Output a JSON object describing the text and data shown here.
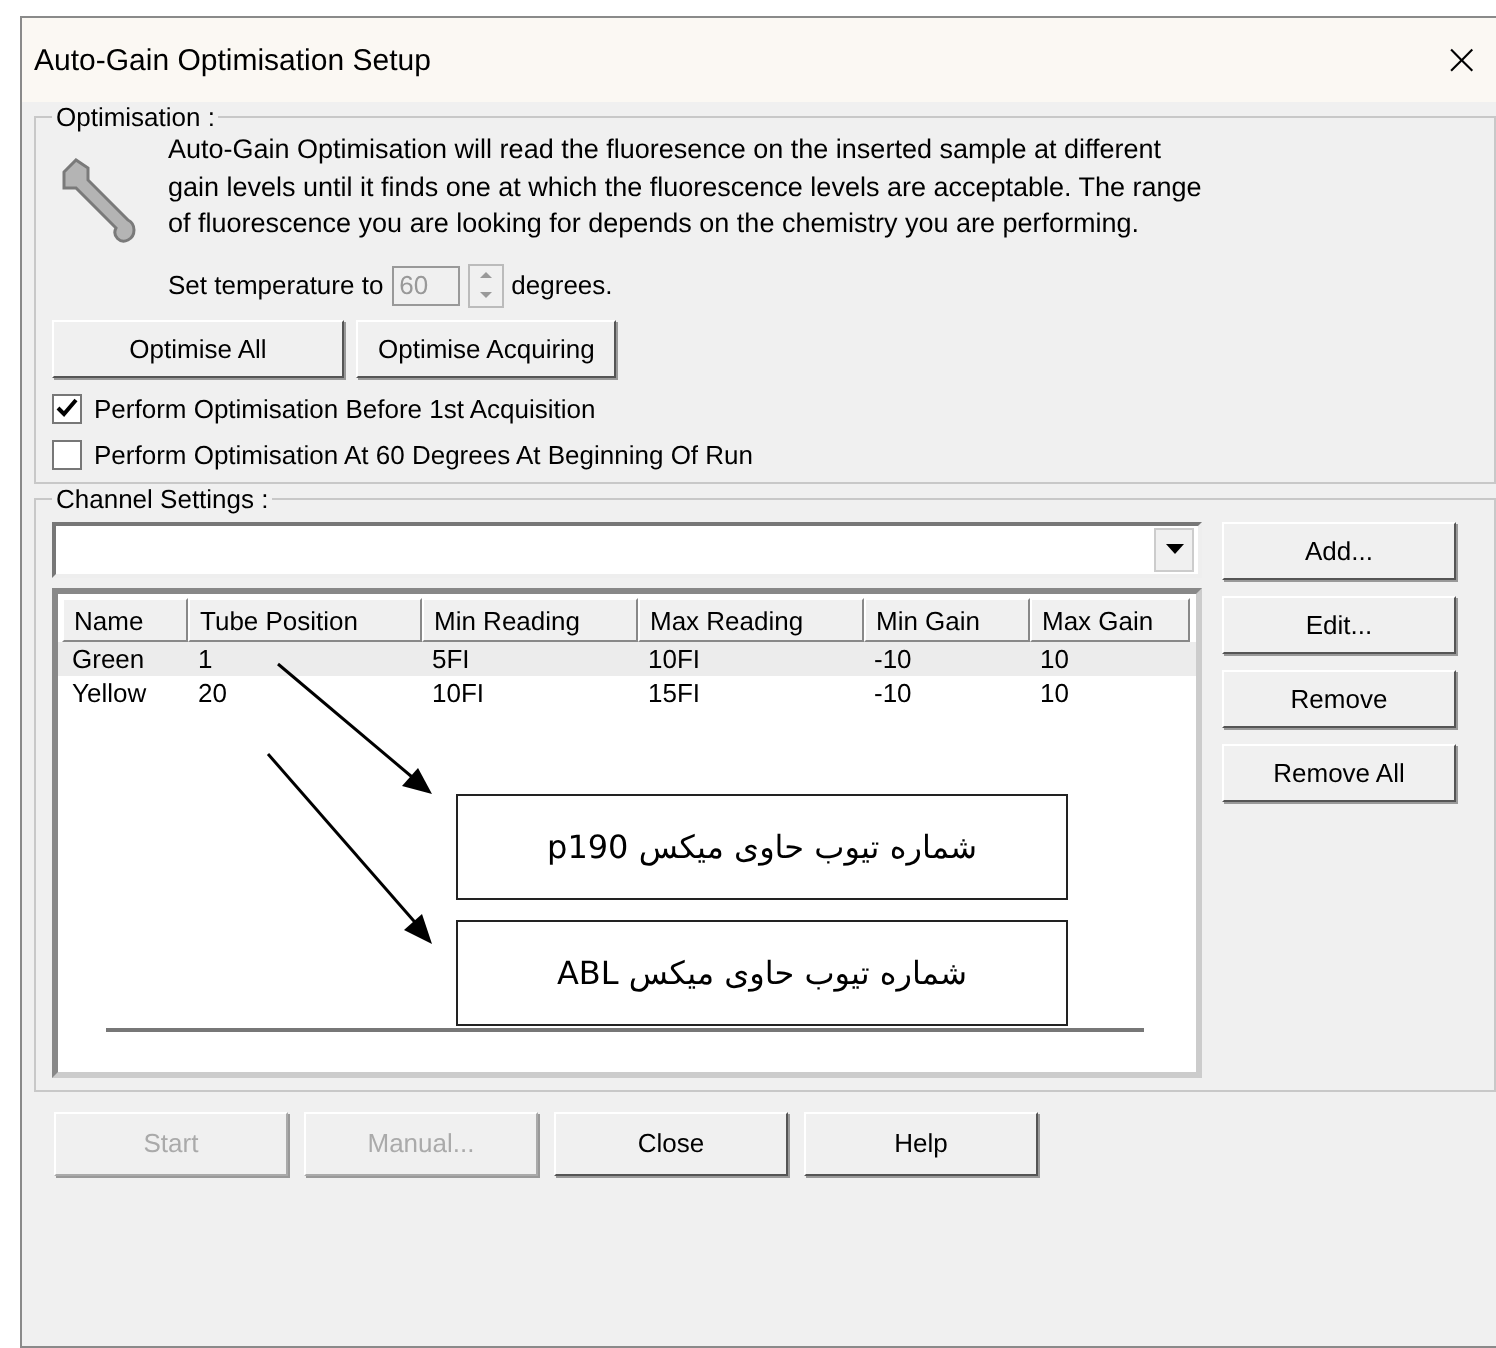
{
  "window": {
    "title": "Auto-Gain Optimisation Setup",
    "close": "×"
  },
  "optimisation": {
    "legend": "Optimisation :",
    "description": "Auto-Gain Optimisation will read the fluoresence on the inserted sample at different gain levels until it finds one at which the fluorescence levels are acceptable. The range of fluorescence you are looking for depends on the chemistry you are performing.",
    "temperature": {
      "label": "Set temperature to",
      "value": "60",
      "unit": "degrees.",
      "disabled": true
    },
    "buttons": [
      {
        "label": "Optimise All"
      },
      {
        "label": "Optimise Acquiring"
      }
    ],
    "options": [
      {
        "label": "Perform Optimisation Before 1st Acquisition",
        "checked": true
      },
      {
        "label": "Perform Optimisation At 60 Degrees At Beginning Of Run",
        "checked": false
      }
    ]
  },
  "channel_settings": {
    "legend": "Channel Settings :",
    "columns": [
      "Name",
      "Tube Position",
      "Min Reading",
      "Max Reading",
      "Min Gain",
      "Max Gain"
    ],
    "rows": [
      {
        "cells": [
          "Green",
          "1",
          "5FI",
          "10FI",
          "-10",
          "10"
        ],
        "selected": true
      },
      {
        "cells": [
          "Yellow",
          "20",
          "10FI",
          "15FI",
          "-10",
          "10"
        ],
        "selected": false
      }
    ],
    "annotations": [
      "شماره تیوب حاوی میکس p190",
      "شماره تیوب حاوی میکس ABL"
    ],
    "buttons": [
      {
        "label": "Add..."
      },
      {
        "label": "Edit..."
      },
      {
        "label": "Remove"
      },
      {
        "label": "Remove All"
      }
    ]
  },
  "footer_buttons": [
    {
      "label": "Start",
      "disabled": true
    },
    {
      "label": "Manual...",
      "disabled": true
    },
    {
      "label": "Close",
      "disabled": false
    },
    {
      "label": "Help",
      "disabled": false
    }
  ]
}
